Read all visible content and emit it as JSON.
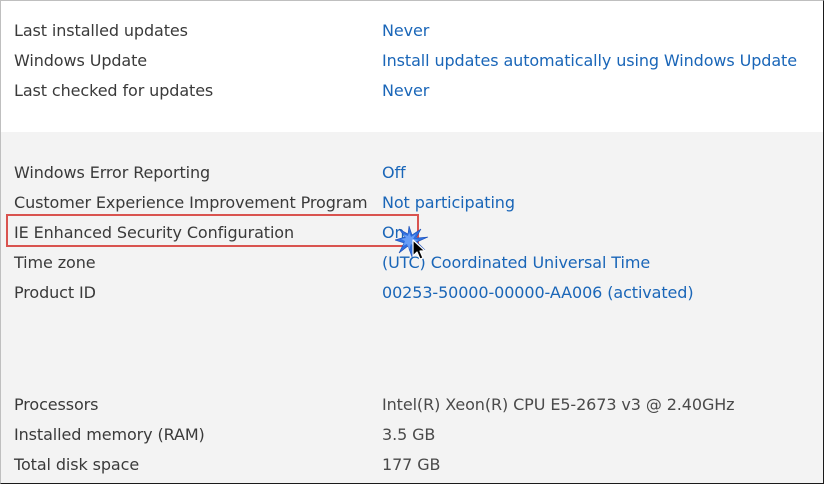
{
  "update_section": {
    "rows": [
      {
        "label": "Last installed updates",
        "value": "Never"
      },
      {
        "label": "Windows Update",
        "value": "Install updates automatically using Windows Update"
      },
      {
        "label": "Last checked for updates",
        "value": "Never"
      }
    ]
  },
  "config_section": {
    "rows": [
      {
        "label": "Windows Error Reporting",
        "value": "Off"
      },
      {
        "label": "Customer Experience Improvement Program",
        "value": "Not participating"
      },
      {
        "label": "IE Enhanced Security Configuration",
        "value": "On"
      },
      {
        "label": "Time zone",
        "value": "(UTC) Coordinated Universal Time"
      },
      {
        "label": "Product ID",
        "value": "00253-50000-00000-AA006 (activated)"
      }
    ]
  },
  "hardware_section": {
    "rows": [
      {
        "label": "Processors",
        "value": "Intel(R) Xeon(R) CPU E5-2673 v3 @ 2.40GHz"
      },
      {
        "label": "Installed memory (RAM)",
        "value": "3.5 GB"
      },
      {
        "label": "Total disk space",
        "value": "177 GB"
      }
    ]
  },
  "colors": {
    "link": "#1a66b8",
    "label": "#3a3a3a",
    "static_value": "#4a4a4a",
    "gray_section_bg": "#f3f3f3",
    "highlight_border": "#d9534f"
  },
  "icons": {
    "cursor": "mouse-pointer-icon",
    "click_indicator": "click-burst-icon"
  }
}
